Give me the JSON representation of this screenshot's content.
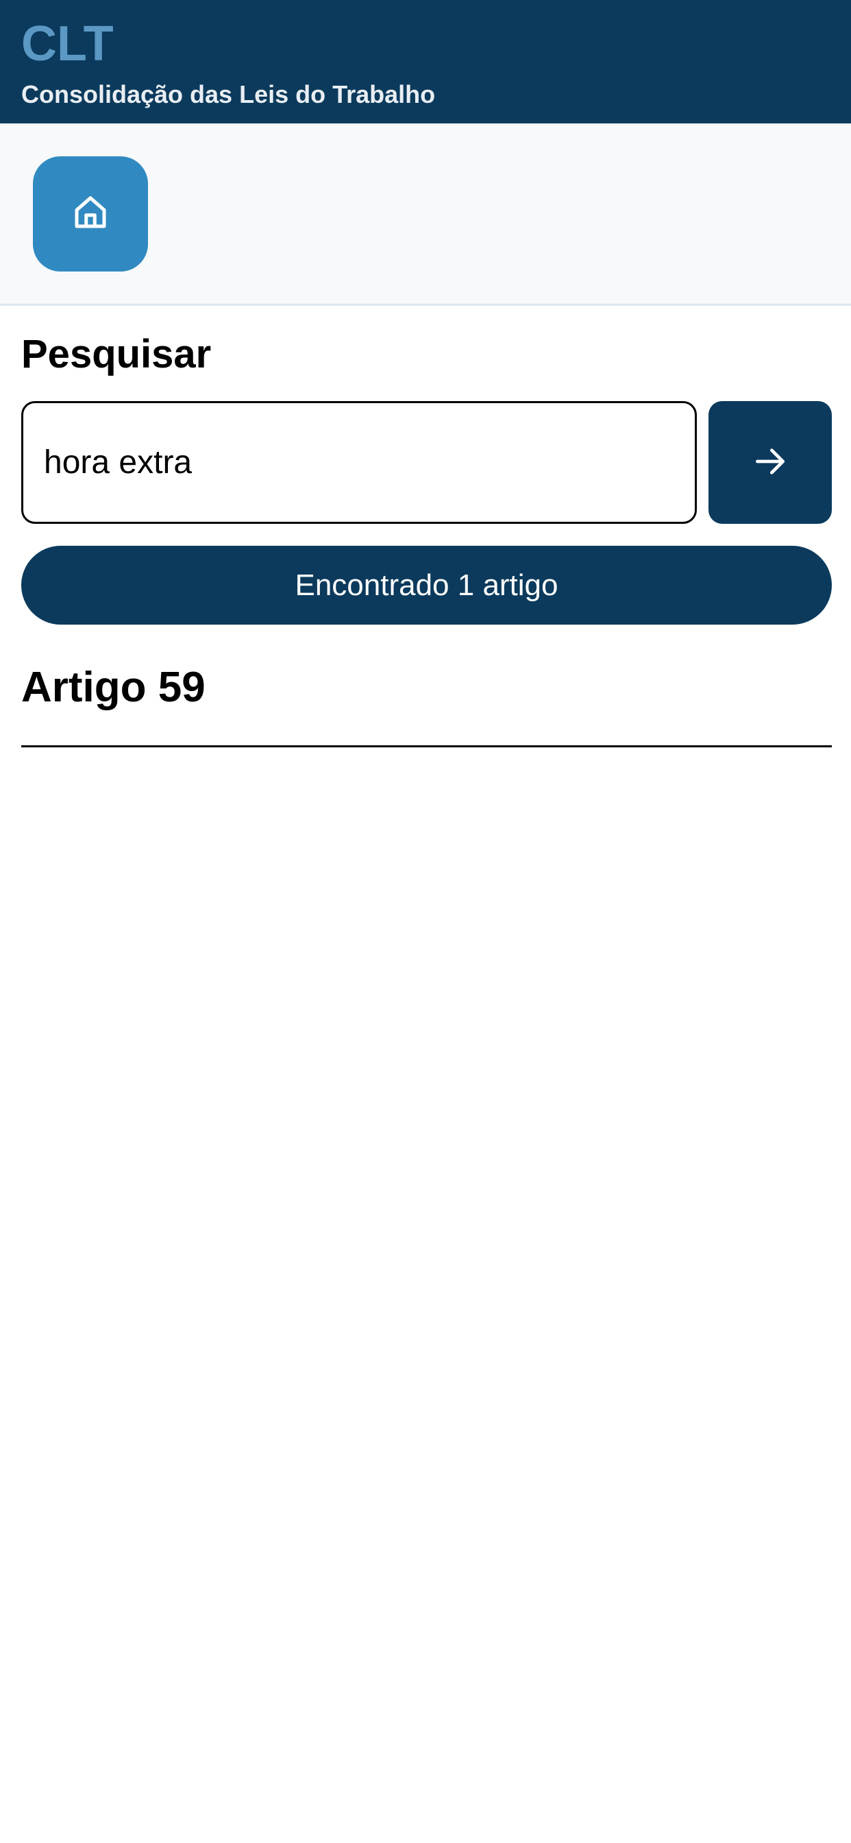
{
  "header": {
    "title": "CLT",
    "subtitle": "Consolidação das Leis do Trabalho"
  },
  "toolbar": {
    "home_icon": "home-icon"
  },
  "search": {
    "title": "Pesquisar",
    "value": "hora extra",
    "submit_icon": "arrow-right-icon"
  },
  "results": {
    "summary": "Encontrado 1 artigo",
    "items": [
      {
        "title": "Artigo 59"
      }
    ]
  },
  "colors": {
    "header_bg": "#0b3a5c",
    "title_accent": "#5b98c4",
    "home_button": "#308ac1",
    "primary": "#0b3a5c"
  }
}
